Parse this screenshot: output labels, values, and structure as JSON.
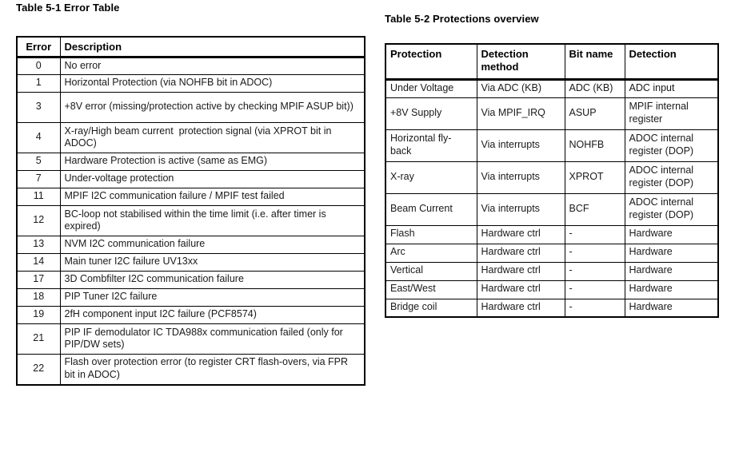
{
  "tables": [
    {
      "id": "table-5-1",
      "title": "Table 5-1 Error Table",
      "columns": [
        "Error",
        "Description"
      ],
      "rows": [
        {
          "error": "0",
          "description": "No error",
          "tall": false
        },
        {
          "error": "1",
          "description": "Horizontal Protection (via NOHFB bit in ADOC)",
          "tall": false
        },
        {
          "error": "3",
          "description": "+8V error (missing/protection active by checking MPIF ASUP bit))",
          "tall": true
        },
        {
          "error": "4",
          "description": "X-ray/High beam current  protection signal (via XPROT bit in ADOC)",
          "tall": true
        },
        {
          "error": "5",
          "description": "Hardware Protection is active (same as EMG)",
          "tall": false
        },
        {
          "error": "7",
          "description": "Under-voltage protection",
          "tall": false
        },
        {
          "error": "11",
          "description": "MPIF I2C communication failure / MPIF test failed",
          "tall": false
        },
        {
          "error": "12",
          "description": "BC-loop not stabilised within the time limit (i.e. after timer is expired)",
          "tall": true
        },
        {
          "error": "13",
          "description": "NVM I2C communication failure",
          "tall": false
        },
        {
          "error": "14",
          "description": "Main tuner I2C failure UV13xx",
          "tall": false
        },
        {
          "error": "17",
          "description": "3D Combfilter I2C communication failure",
          "tall": false
        },
        {
          "error": "18",
          "description": "PIP Tuner I2C failure",
          "tall": false
        },
        {
          "error": "19",
          "description": "2fH component input I2C failure (PCF8574)",
          "tall": false
        },
        {
          "error": "21",
          "description": "PIP IF demodulator IC TDA988x communication failed (only for PIP/DW sets)",
          "tall": true
        },
        {
          "error": "22",
          "description": "Flash over protection error (to register CRT flash-overs, via FPR bit in ADOC)",
          "tall": true
        }
      ]
    },
    {
      "id": "table-5-2",
      "title": "Table 5-2 Protections overview",
      "columns": [
        "Protection",
        "Detection method",
        "Bit name",
        "Detection"
      ],
      "rows": [
        {
          "protection": "Under Voltage",
          "method": "Via ADC (KB)",
          "bit": "ADC (KB)",
          "detection": "ADC input",
          "tall": false
        },
        {
          "protection": "+8V Supply",
          "method": "Via MPIF_IRQ",
          "bit": "ASUP",
          "detection": "MPIF internal register",
          "tall": true
        },
        {
          "protection": "Horizontal fly-back",
          "method": "Via interrupts",
          "bit": "NOHFB",
          "detection": "ADOC internal register (DOP)",
          "tall": true
        },
        {
          "protection": "X-ray",
          "method": "Via interrupts",
          "bit": "XPROT",
          "detection": "ADOC internal register (DOP)",
          "tall": true
        },
        {
          "protection": "Beam Current",
          "method": "Via interrupts",
          "bit": "BCF",
          "detection": "ADOC internal register (DOP)",
          "tall": true
        },
        {
          "protection": "Flash",
          "method": "Hardware ctrl",
          "bit": "-",
          "detection": "Hardware",
          "tall": false
        },
        {
          "protection": "Arc",
          "method": "Hardware ctrl",
          "bit": "-",
          "detection": "Hardware",
          "tall": false
        },
        {
          "protection": "Vertical",
          "method": "Hardware ctrl",
          "bit": "-",
          "detection": "Hardware",
          "tall": false
        },
        {
          "protection": "East/West",
          "method": "Hardware ctrl",
          "bit": "-",
          "detection": "Hardware",
          "tall": false
        },
        {
          "protection": "Bridge coil",
          "method": "Hardware ctrl",
          "bit": "-",
          "detection": "Hardware",
          "tall": false
        }
      ]
    }
  ],
  "colors": {
    "page_background": "#ffffff",
    "text": "#000000",
    "border": "#000000"
  }
}
